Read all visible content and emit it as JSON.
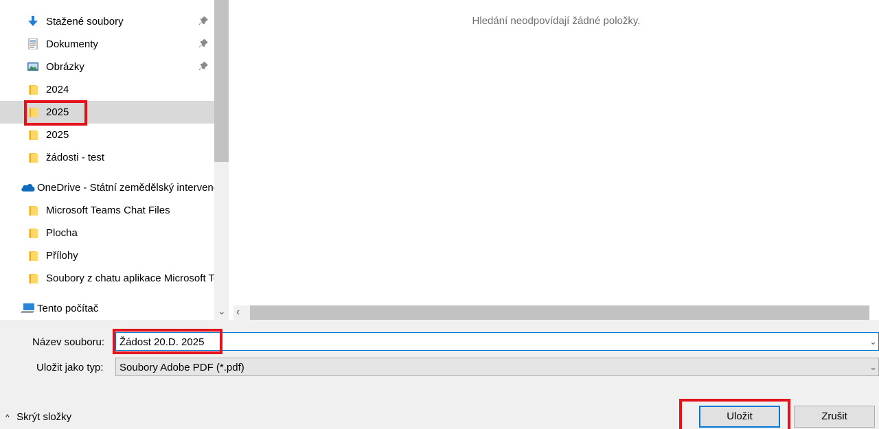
{
  "nav": {
    "items": [
      {
        "label": "Stažené soubory",
        "icon": "download-icon",
        "pinned": true
      },
      {
        "label": "Dokumenty",
        "icon": "documents-icon",
        "pinned": true
      },
      {
        "label": "Obrázky",
        "icon": "pictures-icon",
        "pinned": true
      },
      {
        "label": "2024",
        "icon": "folder-icon"
      },
      {
        "label": "2025",
        "icon": "folder-icon",
        "selected": true
      },
      {
        "label": "2025",
        "icon": "folder-icon"
      },
      {
        "label": "žádosti - test",
        "icon": "folder-icon"
      },
      {
        "label": "OneDrive - Státní zemědělský intervenční fond",
        "icon": "onedrive-icon"
      },
      {
        "label": "Microsoft Teams Chat Files",
        "icon": "folder-icon"
      },
      {
        "label": "Plocha",
        "icon": "folder-icon"
      },
      {
        "label": "Přílohy",
        "icon": "folder-icon"
      },
      {
        "label": "Soubory z chatu aplikace Microsoft Teams",
        "icon": "folder-icon"
      },
      {
        "label": "Tento počítač",
        "icon": "this-pc-icon"
      }
    ]
  },
  "content": {
    "empty_message": "Hledání neodpovídají žádné položky."
  },
  "form": {
    "filename_label": "Název souboru:",
    "filename_value": "Žádost 20.D. 2025",
    "type_label": "Uložit jako typ:",
    "type_value": "Soubory Adobe PDF (*.pdf)"
  },
  "footer": {
    "hide_folders_label": "Skrýt složky",
    "save_label": "Uložit",
    "cancel_label": "Zrušit"
  },
  "colors": {
    "highlight": "#e3121b",
    "accent": "#0078d7",
    "selected_row": "#d9d9d9"
  }
}
